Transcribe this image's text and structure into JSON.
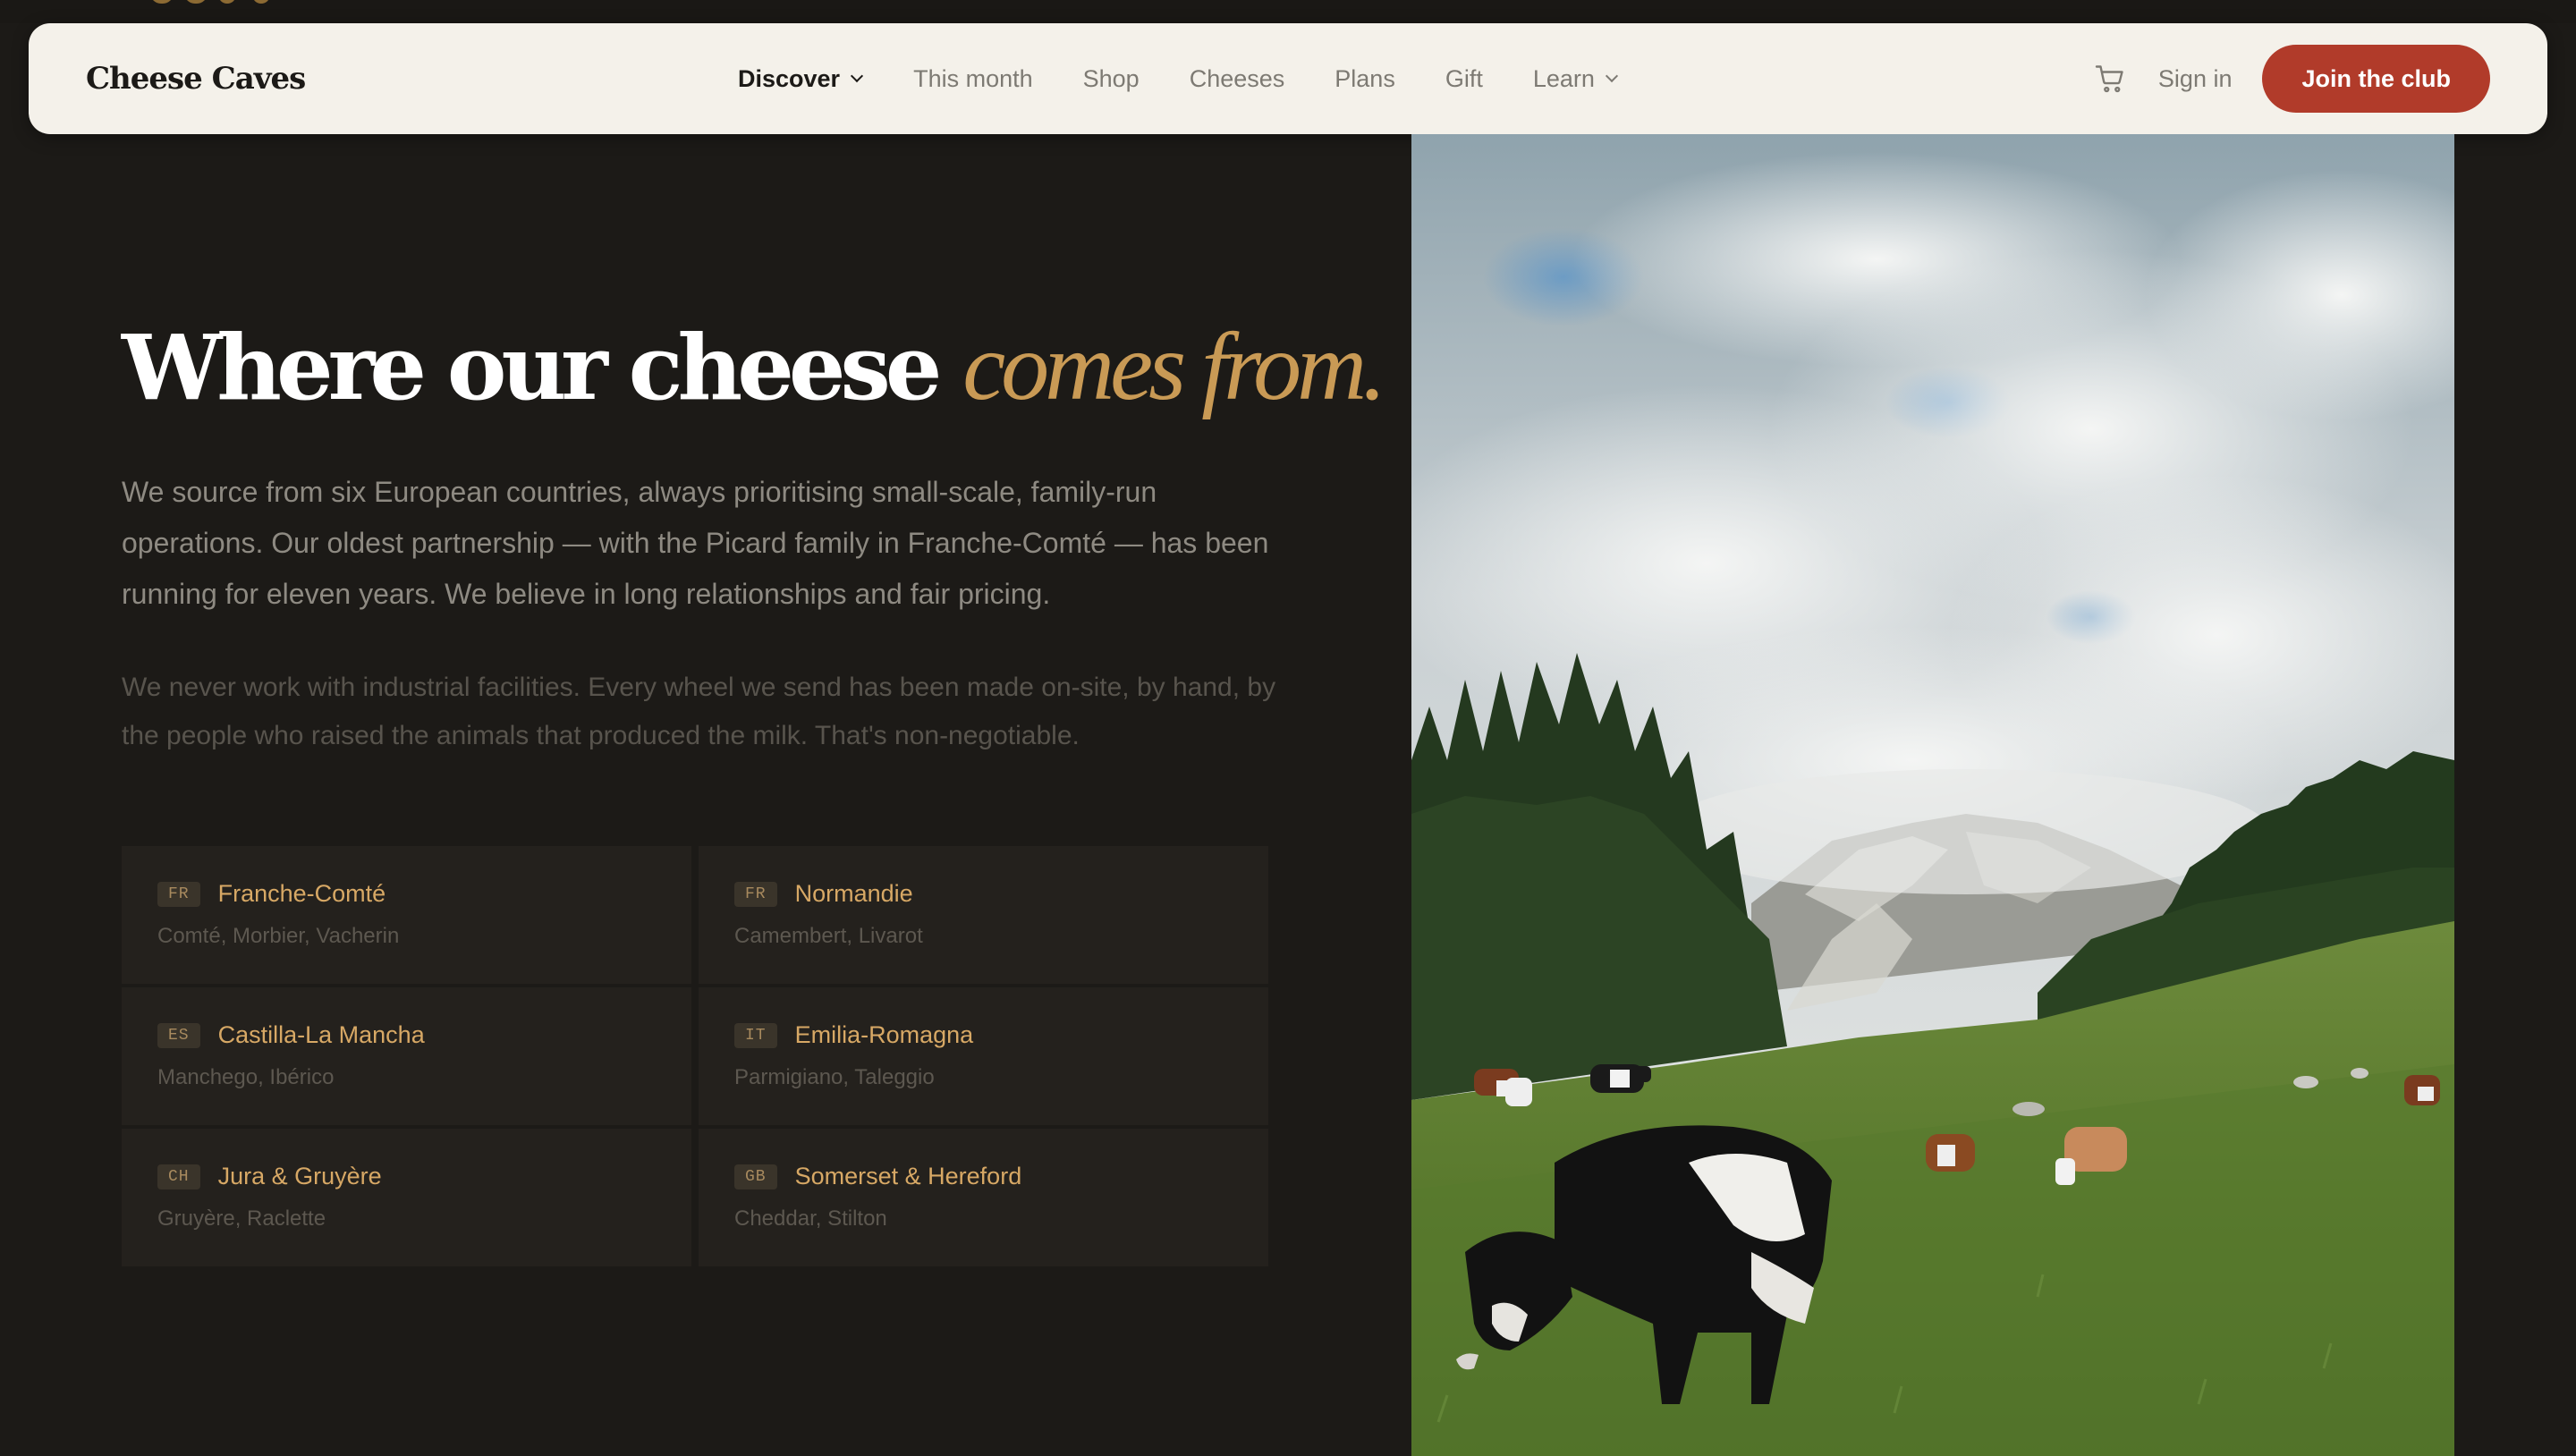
{
  "brand": {
    "name": "Cheese Caves",
    "accent": "#c99a55",
    "cta_color": "#b13b2a",
    "background": "#1c1a17"
  },
  "nav": {
    "items": [
      {
        "label": "Discover",
        "active": true,
        "dropdown": true
      },
      {
        "label": "This month",
        "active": false,
        "dropdown": false
      },
      {
        "label": "Shop",
        "active": false,
        "dropdown": false
      },
      {
        "label": "Cheeses",
        "active": false,
        "dropdown": false
      },
      {
        "label": "Plans",
        "active": false,
        "dropdown": false
      },
      {
        "label": "Gift",
        "active": false,
        "dropdown": false
      },
      {
        "label": "Learn",
        "active": false,
        "dropdown": true
      }
    ],
    "cart_icon": "cart-icon",
    "signin_label": "Sign in",
    "cta_label": "Join the club"
  },
  "hero": {
    "headline_main": "Where our cheese ",
    "headline_accent": "comes from.",
    "lede": "We source from six European countries, always prioritising small-scale, family-run operations. Our oldest partnership — with the Picard family in Franche-Comté — has been running for eleven years. We believe in long relationships and fair pricing.",
    "note": "We never work with industrial facilities. Every wheel we send has been made on-site, by hand, by the people who raised the animals that produced the milk. That's non-negotiable."
  },
  "regions": [
    {
      "code": "FR",
      "name": "Franche-Comté",
      "cheeses": "Comté, Morbier, Vacherin"
    },
    {
      "code": "FR",
      "name": "Normandie",
      "cheeses": "Camembert, Livarot"
    },
    {
      "code": "ES",
      "name": "Castilla-La Mancha",
      "cheeses": "Manchego, Ibérico"
    },
    {
      "code": "IT",
      "name": "Emilia-Romagna",
      "cheeses": "Parmigiano, Taleggio"
    },
    {
      "code": "CH",
      "name": "Jura & Gruyère",
      "cheeses": "Gruyère, Raclette"
    },
    {
      "code": "GB",
      "name": "Somerset & Hereford",
      "cheeses": "Cheddar, Stilton"
    }
  ],
  "photo": {
    "subject": "cows grazing on alpine meadow with mountains and clouds"
  }
}
